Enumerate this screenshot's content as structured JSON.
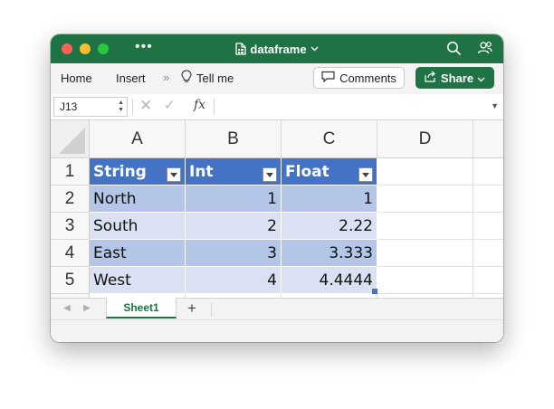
{
  "window": {
    "title": "dataframe",
    "accent_color": "#1f7244"
  },
  "ribbon": {
    "tabs": [
      "Home",
      "Insert"
    ],
    "tell_me": "Tell me",
    "comments_label": "Comments",
    "share_label": "Share"
  },
  "formula_bar": {
    "name_box": "J13",
    "formula": ""
  },
  "sheet": {
    "columns": [
      "A",
      "B",
      "C",
      "D"
    ],
    "rows": [
      "1",
      "2",
      "3",
      "4",
      "5"
    ],
    "headers": [
      "String",
      "Int",
      "Float"
    ],
    "data": [
      [
        "North",
        "1",
        "1"
      ],
      [
        "South",
        "2",
        "2.22"
      ],
      [
        "East",
        "3",
        "3.333"
      ],
      [
        "West",
        "4",
        "4.4444"
      ]
    ],
    "table_colors": {
      "header": "#4472c4",
      "band1": "#b4c6e7",
      "band2": "#d9e1f2"
    }
  },
  "sheet_tabs": {
    "active": "Sheet1",
    "add_label": "+"
  }
}
